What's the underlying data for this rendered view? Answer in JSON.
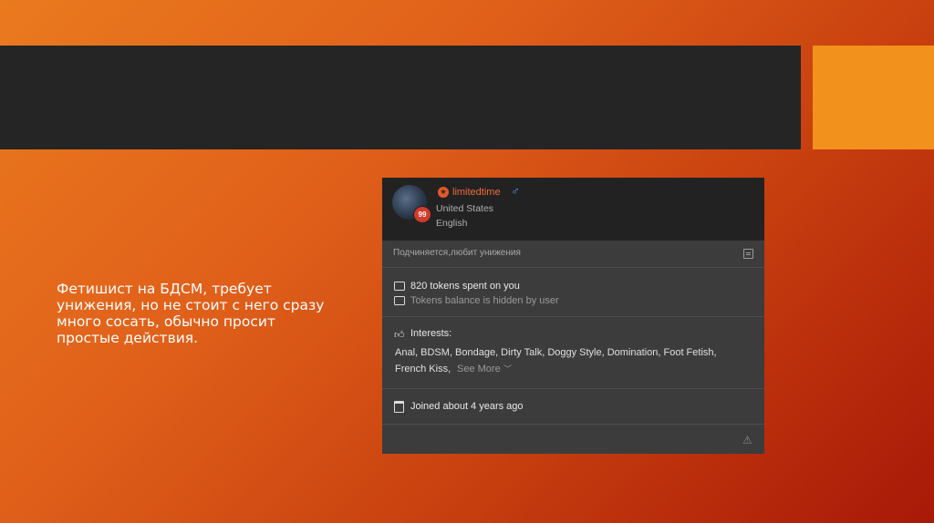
{
  "slide": {
    "body_text": "Фетишист на БДСМ, требует унижения, но не стоит с него сразу много сосать, обычно просит простые действия."
  },
  "profile": {
    "level": "99",
    "username": "limitedtime",
    "gender_symbol": "♂",
    "country": "United States",
    "language": "English",
    "description": "Подчиняется,любит унижения",
    "tokens_spent": "820 tokens spent on you",
    "balance_note": "Tokens balance is hidden by user",
    "interests_label": "Interests:",
    "interests_line1": "Anal, BDSM, Bondage, Dirty Talk, Doggy Style, Domination, Foot Fetish,",
    "interests_line2": "French Kiss,",
    "see_more": "See More",
    "joined": "Joined about 4 years ago"
  },
  "colors": {
    "accent_orange": "#f2921c",
    "dark_bar": "#252525",
    "username": "#f06a3a",
    "gender": "#5c9ce6",
    "badge": "#d23a2c"
  },
  "icons": [
    "star-icon",
    "male-icon",
    "note-icon",
    "coins-icon",
    "wallet-icon",
    "thumbs-up-icon",
    "chevron-down-icon",
    "calendar-icon",
    "warning-icon"
  ]
}
